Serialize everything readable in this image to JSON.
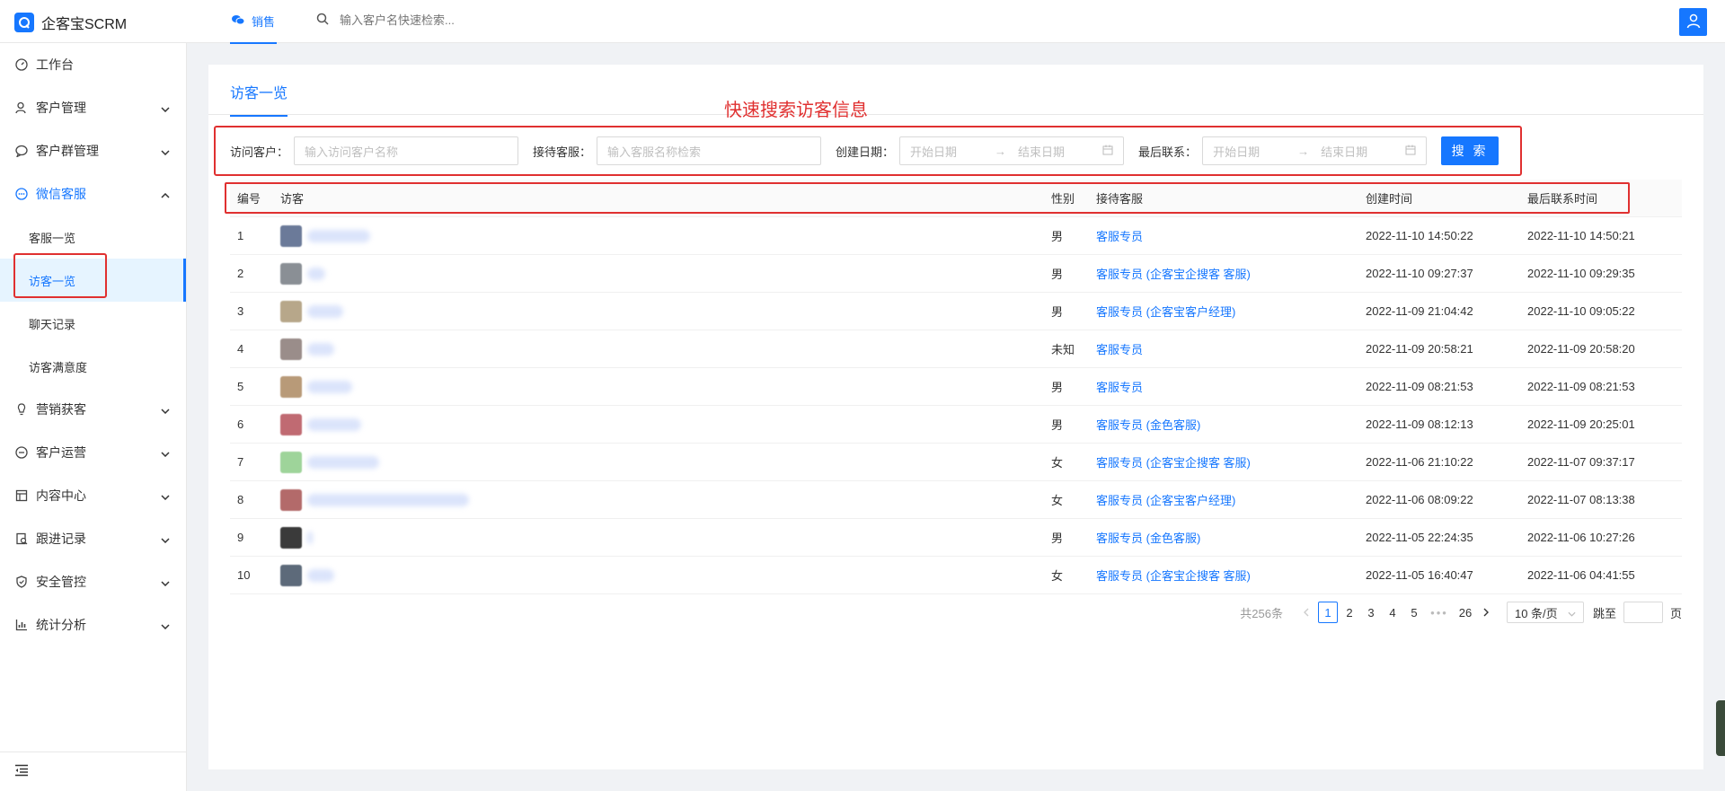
{
  "app": {
    "title": "企客宝SCRM",
    "brand_color": "#1677ff"
  },
  "header": {
    "active_tab": "销售",
    "search_placeholder": "输入客户名快速检索..."
  },
  "sidebar": {
    "items": [
      {
        "label": "工作台",
        "icon": "dashboard-icon"
      },
      {
        "label": "客户管理",
        "icon": "customer-icon"
      },
      {
        "label": "客户群管理",
        "icon": "group-chat-icon"
      },
      {
        "label": "微信客服",
        "icon": "wechat-service-icon"
      },
      {
        "label": "营销获客",
        "icon": "bulb-icon"
      },
      {
        "label": "客户运营",
        "icon": "operation-icon"
      },
      {
        "label": "内容中心",
        "icon": "content-icon"
      },
      {
        "label": "跟进记录",
        "icon": "followup-icon"
      },
      {
        "label": "安全管控",
        "icon": "shield-icon"
      },
      {
        "label": "统计分析",
        "icon": "bar-chart-icon"
      }
    ],
    "subitems": [
      "客服一览",
      "访客一览",
      "聊天记录",
      "访客满意度"
    ]
  },
  "page": {
    "tab": "访客一览",
    "annotation": "快速搜索访客信息"
  },
  "filters": {
    "visitor_label": "访问客户：",
    "visitor_placeholder": "输入访问客户名称",
    "agent_label": "接待客服：",
    "agent_placeholder": "输入客服名称检索",
    "created_label": "创建日期：",
    "last_label": "最后联系：",
    "start_placeholder": "开始日期",
    "arrow": "→",
    "end_placeholder": "结束日期",
    "search_button": "搜 索"
  },
  "table": {
    "columns": [
      "编号",
      "访客",
      "性别",
      "接待客服",
      "创建时间",
      "最后联系时间"
    ],
    "rows": [
      {
        "no": "1",
        "gender": "男",
        "agent": "客服专员",
        "created": "2022-11-10 14:50:22",
        "last": "2022-11-10 14:50:21"
      },
      {
        "no": "2",
        "gender": "男",
        "agent": "客服专员 (企客宝企搜客 客服)",
        "created": "2022-11-10 09:27:37",
        "last": "2022-11-10 09:29:35"
      },
      {
        "no": "3",
        "gender": "男",
        "agent": "客服专员 (企客宝客户经理)",
        "created": "2022-11-09 21:04:42",
        "last": "2022-11-10 09:05:22"
      },
      {
        "no": "4",
        "gender": "未知",
        "agent": "客服专员",
        "created": "2022-11-09 20:58:21",
        "last": "2022-11-09 20:58:20"
      },
      {
        "no": "5",
        "gender": "男",
        "agent": "客服专员",
        "created": "2022-11-09 08:21:53",
        "last": "2022-11-09 08:21:53"
      },
      {
        "no": "6",
        "gender": "男",
        "agent": "客服专员 (金色客服)",
        "created": "2022-11-09 08:12:13",
        "last": "2022-11-09 20:25:01"
      },
      {
        "no": "7",
        "gender": "女",
        "agent": "客服专员 (企客宝企搜客 客服)",
        "created": "2022-11-06 21:10:22",
        "last": "2022-11-07 09:37:17"
      },
      {
        "no": "8",
        "gender": "女",
        "agent": "客服专员 (企客宝客户经理)",
        "created": "2022-11-06 08:09:22",
        "last": "2022-11-07 08:13:38"
      },
      {
        "no": "9",
        "gender": "男",
        "agent": "客服专员 (金色客服)",
        "created": "2022-11-05 22:24:35",
        "last": "2022-11-06 10:27:26"
      },
      {
        "no": "10",
        "gender": "女",
        "agent": "客服专员 (企客宝企搜客 客服)",
        "created": "2022-11-05 16:40:47",
        "last": "2022-11-06 04:41:55"
      }
    ]
  },
  "pagination": {
    "total": "共256条",
    "pages": [
      "1",
      "2",
      "3",
      "4",
      "5"
    ],
    "ellipsis": "•••",
    "last_page": "26",
    "page_size": "10 条/页",
    "jump_label": "跳至",
    "page_unit": "页"
  }
}
